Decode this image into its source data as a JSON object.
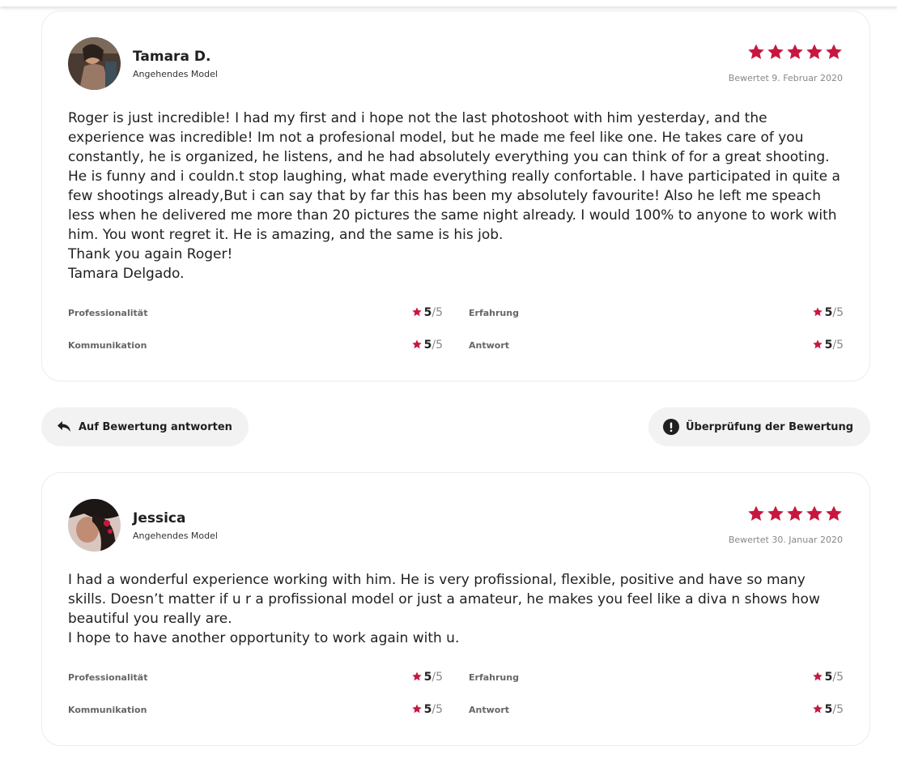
{
  "colors": {
    "accent": "#c8173f",
    "text": "#1f1f1f",
    "muted": "#888888",
    "button_bg": "#f2f2f2",
    "border": "#ececec"
  },
  "reviews": [
    {
      "name": "Tamara D.",
      "role": "Angehendes Model",
      "stars": 5,
      "date": "Bewertet 9. Februar 2020",
      "text": [
        "Roger is just incredible! I had my first and i hope not the last photoshoot with him yesterday, and the experience was incredible! Im not a profesional model, but he made me feel like one. He takes care of you constantly, he is organized, he listens, and he had absolutely everything you can think of for a great shooting. He is funny and i couldn.t stop laughing, what made everything really confortable. I have participated in quite a few shootings already,But i can say that by far this has been my absolutely favourite! Also he left me speach less when he delivered me more than 20 pictures the same night already. I would 100% to anyone to work with him. You wont regret it. He is amazing, and the same is his job.",
        "Thank you again Roger!",
        "Tamara Delgado."
      ],
      "ratings": [
        {
          "label": "Professionalität",
          "value": "5",
          "max": "/5"
        },
        {
          "label": "Erfahrung",
          "value": "5",
          "max": "/5"
        },
        {
          "label": "Kommunikation",
          "value": "5",
          "max": "/5"
        },
        {
          "label": "Antwort",
          "value": "5",
          "max": "/5"
        }
      ]
    },
    {
      "name": "Jessica",
      "role": "Angehendes Model",
      "stars": 5,
      "date": "Bewertet 30. Januar 2020",
      "text": [
        "I had a wonderful experience working with him. He is very profissional, flexible, positive and have so many skills. Doesn’t matter if u r a profissional model or just a amateur, he makes you feel like a diva n shows how beautiful you really are.",
        "I hope to have another opportunity to work again with u."
      ],
      "ratings": [
        {
          "label": "Professionalität",
          "value": "5",
          "max": "/5"
        },
        {
          "label": "Erfahrung",
          "value": "5",
          "max": "/5"
        },
        {
          "label": "Kommunikation",
          "value": "5",
          "max": "/5"
        },
        {
          "label": "Antwort",
          "value": "5",
          "max": "/5"
        }
      ]
    }
  ],
  "actions": {
    "reply_label": "Auf Bewertung antworten",
    "reply_icon": "reply-arrow-icon",
    "report_label": "Überprüfung der Bewertung",
    "report_icon": "alert-circle-icon"
  }
}
